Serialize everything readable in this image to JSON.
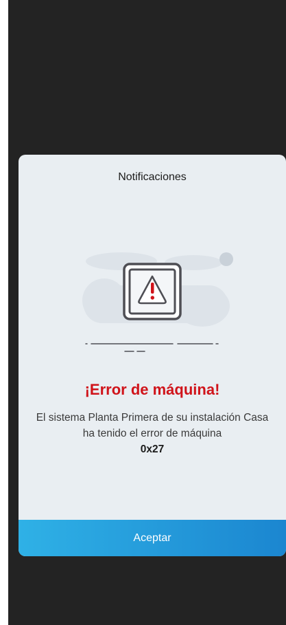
{
  "dialog": {
    "title": "Notificaciones",
    "error_title": "¡Error de máquina!",
    "message": "El sistema Planta Primera  de su instalación Casa ha tenido el error de máquina",
    "error_code": "0x27",
    "accept_label": "Aceptar"
  },
  "icons": {
    "illustration": "machine-warning-icon"
  },
  "colors": {
    "background": "#232323",
    "dialog_background": "#e9eef2",
    "error": "#d0131a",
    "button_start": "#2fb1e6",
    "button_end": "#1b86d0"
  }
}
